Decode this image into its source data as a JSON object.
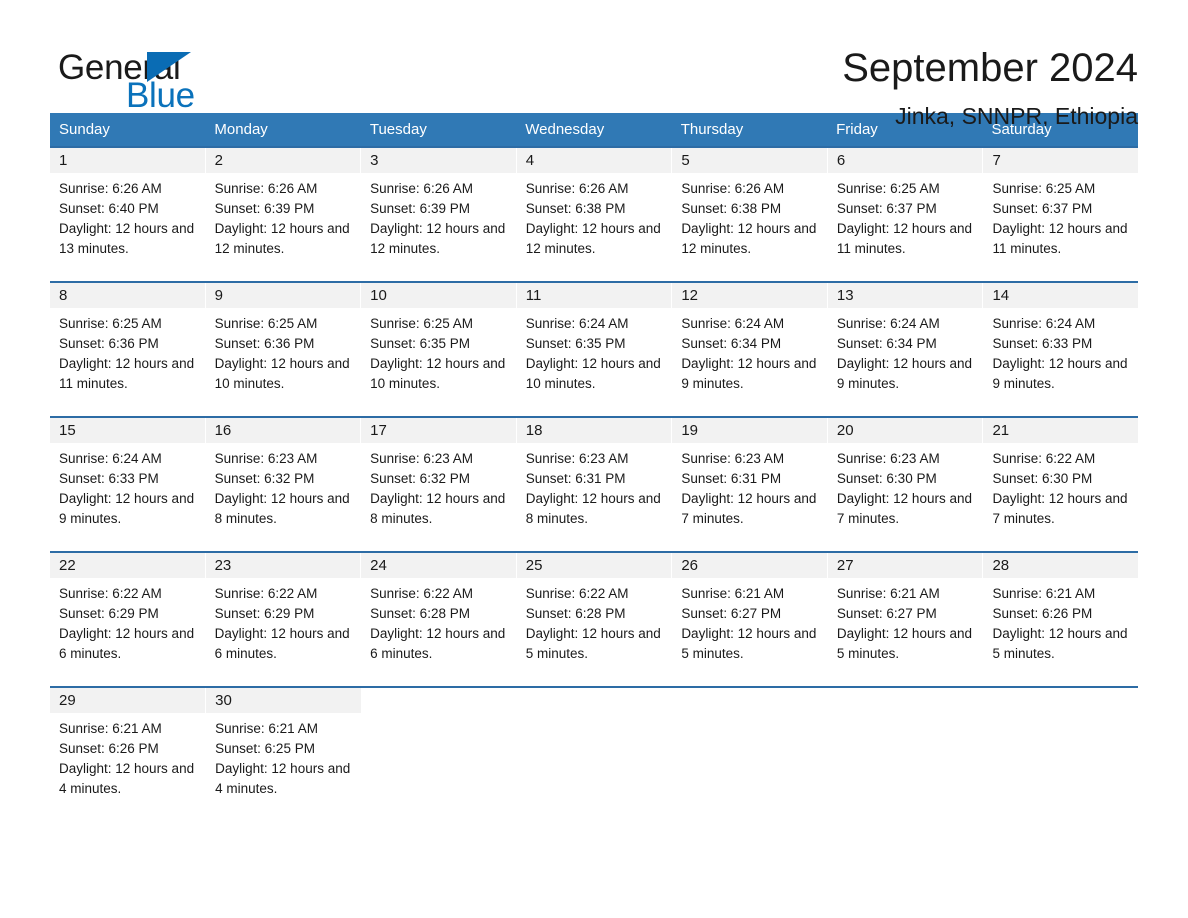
{
  "brand": {
    "name_part1": "General",
    "name_part2": "Blue",
    "accent_color": "#0a6cb4"
  },
  "header": {
    "month_title": "September 2024",
    "location": "Jinka, SNNPR, Ethiopia",
    "header_bg_color": "#3079b5",
    "row_divider_color": "#2d6ca5",
    "daynum_band_color": "#f2f2f2"
  },
  "weekdays": [
    "Sunday",
    "Monday",
    "Tuesday",
    "Wednesday",
    "Thursday",
    "Friday",
    "Saturday"
  ],
  "weeks": [
    {
      "days": [
        {
          "num": "1",
          "sunrise": "Sunrise: 6:26 AM",
          "sunset": "Sunset: 6:40 PM",
          "daylight": "Daylight: 12 hours and 13 minutes."
        },
        {
          "num": "2",
          "sunrise": "Sunrise: 6:26 AM",
          "sunset": "Sunset: 6:39 PM",
          "daylight": "Daylight: 12 hours and 12 minutes."
        },
        {
          "num": "3",
          "sunrise": "Sunrise: 6:26 AM",
          "sunset": "Sunset: 6:39 PM",
          "daylight": "Daylight: 12 hours and 12 minutes."
        },
        {
          "num": "4",
          "sunrise": "Sunrise: 6:26 AM",
          "sunset": "Sunset: 6:38 PM",
          "daylight": "Daylight: 12 hours and 12 minutes."
        },
        {
          "num": "5",
          "sunrise": "Sunrise: 6:26 AM",
          "sunset": "Sunset: 6:38 PM",
          "daylight": "Daylight: 12 hours and 12 minutes."
        },
        {
          "num": "6",
          "sunrise": "Sunrise: 6:25 AM",
          "sunset": "Sunset: 6:37 PM",
          "daylight": "Daylight: 12 hours and 11 minutes."
        },
        {
          "num": "7",
          "sunrise": "Sunrise: 6:25 AM",
          "sunset": "Sunset: 6:37 PM",
          "daylight": "Daylight: 12 hours and 11 minutes."
        }
      ]
    },
    {
      "days": [
        {
          "num": "8",
          "sunrise": "Sunrise: 6:25 AM",
          "sunset": "Sunset: 6:36 PM",
          "daylight": "Daylight: 12 hours and 11 minutes."
        },
        {
          "num": "9",
          "sunrise": "Sunrise: 6:25 AM",
          "sunset": "Sunset: 6:36 PM",
          "daylight": "Daylight: 12 hours and 10 minutes."
        },
        {
          "num": "10",
          "sunrise": "Sunrise: 6:25 AM",
          "sunset": "Sunset: 6:35 PM",
          "daylight": "Daylight: 12 hours and 10 minutes."
        },
        {
          "num": "11",
          "sunrise": "Sunrise: 6:24 AM",
          "sunset": "Sunset: 6:35 PM",
          "daylight": "Daylight: 12 hours and 10 minutes."
        },
        {
          "num": "12",
          "sunrise": "Sunrise: 6:24 AM",
          "sunset": "Sunset: 6:34 PM",
          "daylight": "Daylight: 12 hours and 9 minutes."
        },
        {
          "num": "13",
          "sunrise": "Sunrise: 6:24 AM",
          "sunset": "Sunset: 6:34 PM",
          "daylight": "Daylight: 12 hours and 9 minutes."
        },
        {
          "num": "14",
          "sunrise": "Sunrise: 6:24 AM",
          "sunset": "Sunset: 6:33 PM",
          "daylight": "Daylight: 12 hours and 9 minutes."
        }
      ]
    },
    {
      "days": [
        {
          "num": "15",
          "sunrise": "Sunrise: 6:24 AM",
          "sunset": "Sunset: 6:33 PM",
          "daylight": "Daylight: 12 hours and 9 minutes."
        },
        {
          "num": "16",
          "sunrise": "Sunrise: 6:23 AM",
          "sunset": "Sunset: 6:32 PM",
          "daylight": "Daylight: 12 hours and 8 minutes."
        },
        {
          "num": "17",
          "sunrise": "Sunrise: 6:23 AM",
          "sunset": "Sunset: 6:32 PM",
          "daylight": "Daylight: 12 hours and 8 minutes."
        },
        {
          "num": "18",
          "sunrise": "Sunrise: 6:23 AM",
          "sunset": "Sunset: 6:31 PM",
          "daylight": "Daylight: 12 hours and 8 minutes."
        },
        {
          "num": "19",
          "sunrise": "Sunrise: 6:23 AM",
          "sunset": "Sunset: 6:31 PM",
          "daylight": "Daylight: 12 hours and 7 minutes."
        },
        {
          "num": "20",
          "sunrise": "Sunrise: 6:23 AM",
          "sunset": "Sunset: 6:30 PM",
          "daylight": "Daylight: 12 hours and 7 minutes."
        },
        {
          "num": "21",
          "sunrise": "Sunrise: 6:22 AM",
          "sunset": "Sunset: 6:30 PM",
          "daylight": "Daylight: 12 hours and 7 minutes."
        }
      ]
    },
    {
      "days": [
        {
          "num": "22",
          "sunrise": "Sunrise: 6:22 AM",
          "sunset": "Sunset: 6:29 PM",
          "daylight": "Daylight: 12 hours and 6 minutes."
        },
        {
          "num": "23",
          "sunrise": "Sunrise: 6:22 AM",
          "sunset": "Sunset: 6:29 PM",
          "daylight": "Daylight: 12 hours and 6 minutes."
        },
        {
          "num": "24",
          "sunrise": "Sunrise: 6:22 AM",
          "sunset": "Sunset: 6:28 PM",
          "daylight": "Daylight: 12 hours and 6 minutes."
        },
        {
          "num": "25",
          "sunrise": "Sunrise: 6:22 AM",
          "sunset": "Sunset: 6:28 PM",
          "daylight": "Daylight: 12 hours and 5 minutes."
        },
        {
          "num": "26",
          "sunrise": "Sunrise: 6:21 AM",
          "sunset": "Sunset: 6:27 PM",
          "daylight": "Daylight: 12 hours and 5 minutes."
        },
        {
          "num": "27",
          "sunrise": "Sunrise: 6:21 AM",
          "sunset": "Sunset: 6:27 PM",
          "daylight": "Daylight: 12 hours and 5 minutes."
        },
        {
          "num": "28",
          "sunrise": "Sunrise: 6:21 AM",
          "sunset": "Sunset: 6:26 PM",
          "daylight": "Daylight: 12 hours and 5 minutes."
        }
      ]
    },
    {
      "days": [
        {
          "num": "29",
          "sunrise": "Sunrise: 6:21 AM",
          "sunset": "Sunset: 6:26 PM",
          "daylight": "Daylight: 12 hours and 4 minutes."
        },
        {
          "num": "30",
          "sunrise": "Sunrise: 6:21 AM",
          "sunset": "Sunset: 6:25 PM",
          "daylight": "Daylight: 12 hours and 4 minutes."
        }
      ]
    }
  ]
}
